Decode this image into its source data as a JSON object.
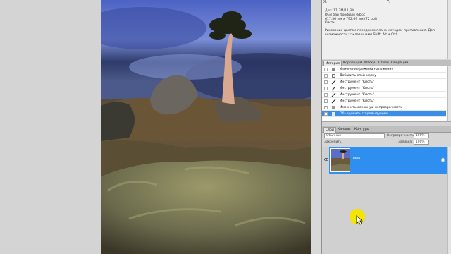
{
  "info": {
    "top_left_labels": [
      "X:",
      "Y:"
    ],
    "doc_lines": [
      "Док: 11,3M/11,3M",
      "RGB бар профиля (8bpc)",
      "617,36 мм x 792,69 мм (72 ррі)",
      "Кисть"
    ],
    "description": "Рисование цветом переднего плана методом противления. Доп. возможности: с клавишами Shift, Alt и Ctrl."
  },
  "history_tabs": [
    "История",
    "Коррекция",
    "Маски",
    "Стили",
    "Операции"
  ],
  "history_items": [
    {
      "label": "Изменение режима наложения",
      "icon": "blend-icon",
      "selected": false
    },
    {
      "label": "Добавить слой-маску",
      "icon": "mask-icon",
      "selected": false
    },
    {
      "label": "Инструмент \"Кисть\"",
      "icon": "brush-icon",
      "selected": false
    },
    {
      "label": "Инструмент \"Кисть\"",
      "icon": "brush-icon",
      "selected": false
    },
    {
      "label": "Инструмент \"Кисть\"",
      "icon": "brush-icon",
      "selected": false
    },
    {
      "label": "Инструмент \"Кисть\"",
      "icon": "brush-icon",
      "selected": false
    },
    {
      "label": "Изменить основную непрозрачность",
      "icon": "opacity-icon",
      "selected": false
    },
    {
      "label": "Объединить с предыдущим",
      "icon": "merge-icon",
      "selected": true
    }
  ],
  "layers_tabs": [
    "Слои",
    "Каналы",
    "Контуры"
  ],
  "layers": {
    "blend_mode": "Обычные",
    "opacity_label": "Непрозрачность:",
    "opacity_value": "100%",
    "lock_label": "Закрепить:",
    "fill_label": "Заливка:",
    "fill_value": "100%",
    "items": [
      {
        "name": "Фон",
        "visible": true,
        "locked": true
      }
    ]
  },
  "colors": {
    "selection": "#3a8ee8",
    "layer_selected": "#2f8ff0",
    "cursor_highlight": "#f5e400"
  }
}
